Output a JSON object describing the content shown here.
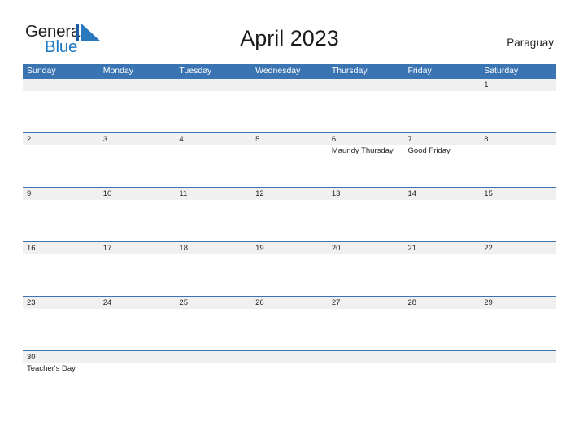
{
  "brand": {
    "name_top": "General",
    "name_bottom": "Blue",
    "mark_icon": "general-blue-sail-logo",
    "color_blue": "#1b77c2",
    "color_dark": "#231f20"
  },
  "header": {
    "title": "April 2023",
    "country": "Paraguay"
  },
  "theme": {
    "header_blue": "#3b74b2",
    "row_band_gray": "#f0f0f0",
    "text_dark": "#231f20",
    "page_bg": "#ffffff"
  },
  "calendar": {
    "weekday_headers": [
      "Sunday",
      "Monday",
      "Tuesday",
      "Wednesday",
      "Thursday",
      "Friday",
      "Saturday"
    ],
    "weeks": [
      {
        "days": [
          {
            "number": "",
            "event": ""
          },
          {
            "number": "",
            "event": ""
          },
          {
            "number": "",
            "event": ""
          },
          {
            "number": "",
            "event": ""
          },
          {
            "number": "",
            "event": ""
          },
          {
            "number": "",
            "event": ""
          },
          {
            "number": "1",
            "event": ""
          }
        ]
      },
      {
        "days": [
          {
            "number": "2",
            "event": ""
          },
          {
            "number": "3",
            "event": ""
          },
          {
            "number": "4",
            "event": ""
          },
          {
            "number": "5",
            "event": ""
          },
          {
            "number": "6",
            "event": "Maundy Thursday"
          },
          {
            "number": "7",
            "event": "Good Friday"
          },
          {
            "number": "8",
            "event": ""
          }
        ]
      },
      {
        "days": [
          {
            "number": "9",
            "event": ""
          },
          {
            "number": "10",
            "event": ""
          },
          {
            "number": "11",
            "event": ""
          },
          {
            "number": "12",
            "event": ""
          },
          {
            "number": "13",
            "event": ""
          },
          {
            "number": "14",
            "event": ""
          },
          {
            "number": "15",
            "event": ""
          }
        ]
      },
      {
        "days": [
          {
            "number": "16",
            "event": ""
          },
          {
            "number": "17",
            "event": ""
          },
          {
            "number": "18",
            "event": ""
          },
          {
            "number": "19",
            "event": ""
          },
          {
            "number": "20",
            "event": ""
          },
          {
            "number": "21",
            "event": ""
          },
          {
            "number": "22",
            "event": ""
          }
        ]
      },
      {
        "days": [
          {
            "number": "23",
            "event": ""
          },
          {
            "number": "24",
            "event": ""
          },
          {
            "number": "25",
            "event": ""
          },
          {
            "number": "26",
            "event": ""
          },
          {
            "number": "27",
            "event": ""
          },
          {
            "number": "28",
            "event": ""
          },
          {
            "number": "29",
            "event": ""
          }
        ]
      },
      {
        "days": [
          {
            "number": "30",
            "event": "Teacher's Day"
          },
          {
            "number": "",
            "event": ""
          },
          {
            "number": "",
            "event": ""
          },
          {
            "number": "",
            "event": ""
          },
          {
            "number": "",
            "event": ""
          },
          {
            "number": "",
            "event": ""
          },
          {
            "number": "",
            "event": ""
          }
        ]
      }
    ]
  }
}
